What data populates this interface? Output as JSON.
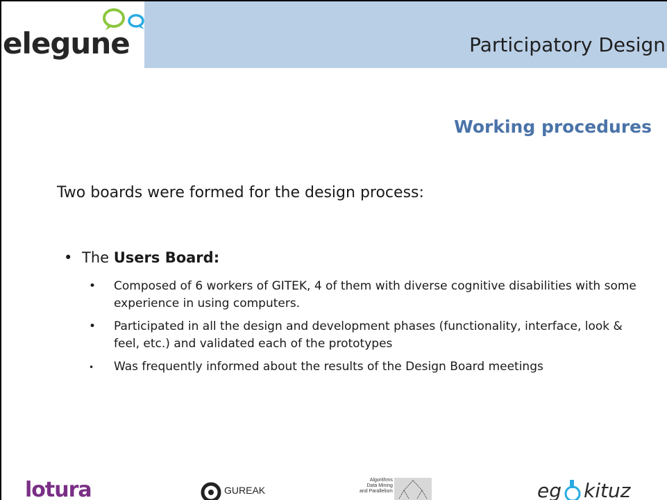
{
  "header": {
    "logo_text": "elegune",
    "title": "Participatory Design"
  },
  "subtitle": "Working procedures",
  "intro": "Two boards were formed for the design process:",
  "bullet": {
    "prefix": "The ",
    "bold": "Users Board:"
  },
  "subitems": [
    "Composed of 6 workers of GITEK, 4 of them with diverse cognitive disabilities with some experience in using computers.",
    "Participated in all the design and development phases (functionality, interface, look & feel, etc.) and validated each of the prototypes",
    "Was frequently informed about the results of the Design Board meetings"
  ],
  "footer": {
    "lotura": "lotura",
    "gureak": "GUREAK",
    "aldapa_lines": [
      "Algorithms",
      "Data Mining",
      "and Parallelism"
    ],
    "egokituz_left": "eg",
    "egokituz_right": "kituz"
  },
  "colors": {
    "header_band": "#b9cfe6",
    "subtitle": "#4a73a8",
    "bubble_green": "#8cc63f",
    "bubble_blue": "#29abe2",
    "lotura": "#7a2f86"
  },
  "icons": [
    "speech-bubbles-icon",
    "gureak-mark-icon",
    "aldapa-graph-icon",
    "wheelchair-icon"
  ]
}
